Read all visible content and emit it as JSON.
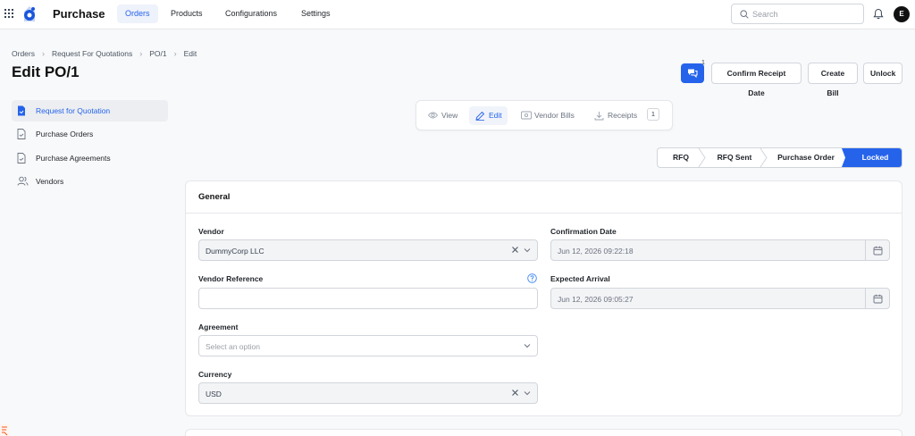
{
  "topbar": {
    "app_title": "Purchase",
    "nav": [
      {
        "label": "Orders",
        "active": true
      },
      {
        "label": "Products",
        "active": false
      },
      {
        "label": "Configurations",
        "active": false
      },
      {
        "label": "Settings",
        "active": false
      }
    ],
    "search_placeholder": "Search",
    "avatar_initial": "E"
  },
  "breadcrumb": [
    "Orders",
    "Request For Quotations",
    "PO/1",
    "Edit"
  ],
  "page_title": "Edit PO/1",
  "actions": {
    "chat_count": "1",
    "confirm_receipt_date": "Confirm Receipt Date",
    "create_bill": "Create Bill",
    "unlock": "Unlock"
  },
  "sidebar": {
    "items": [
      {
        "label": "Request for Quotation",
        "icon": "rfq-file-icon",
        "active": true
      },
      {
        "label": "Purchase Orders",
        "icon": "document-icon",
        "active": false
      },
      {
        "label": "Purchase Agreements",
        "icon": "document-icon",
        "active": false
      },
      {
        "label": "Vendors",
        "icon": "users-icon",
        "active": false
      }
    ]
  },
  "view_tabs": [
    {
      "label": "View",
      "icon": "eye-icon",
      "active": false
    },
    {
      "label": "Edit",
      "icon": "pencil-icon",
      "active": true
    },
    {
      "label": "Vendor Bills",
      "icon": "bill-icon",
      "active": false
    },
    {
      "label": "Receipts",
      "icon": "download-icon",
      "active": false,
      "count": "1"
    }
  ],
  "status_stages": [
    {
      "label": "RFQ",
      "active": false
    },
    {
      "label": "RFQ Sent",
      "active": false
    },
    {
      "label": "Purchase Order",
      "active": false
    },
    {
      "label": "Locked",
      "active": true
    }
  ],
  "form": {
    "section_title": "General",
    "vendor": {
      "label": "Vendor",
      "value": "DummyCorp LLC"
    },
    "vendor_reference": {
      "label": "Vendor Reference",
      "value": ""
    },
    "agreement": {
      "label": "Agreement",
      "placeholder": "Select an option"
    },
    "currency": {
      "label": "Currency",
      "value": "USD"
    },
    "confirmation_date": {
      "label": "Confirmation Date",
      "value": "Jun 12, 2026 09:22:18"
    },
    "expected_arrival": {
      "label": "Expected Arrival",
      "value": "Jun 12, 2026 09:05:27"
    }
  },
  "colors": {
    "accent": "#2563eb",
    "active_bg": "#eef2fb",
    "border": "#d1d5db"
  }
}
